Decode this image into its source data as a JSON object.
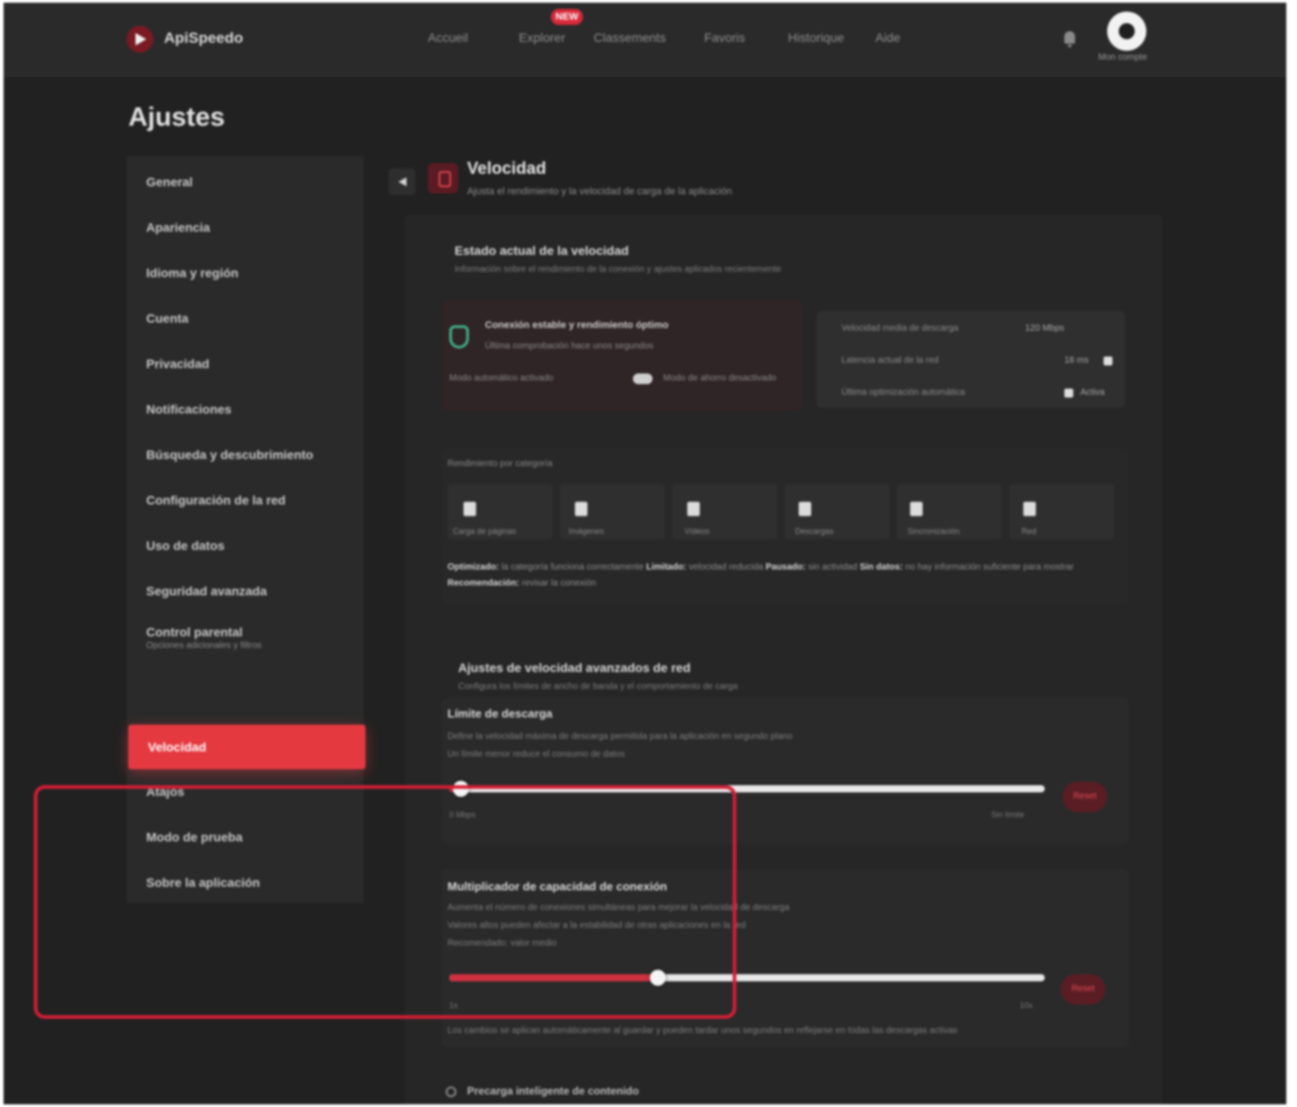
{
  "header": {
    "logo_text": "ApiSpeedo",
    "nav": [
      {
        "label": "Accueil"
      },
      {
        "label": "Explorer"
      },
      {
        "label": "Classements"
      },
      {
        "label": "Favoris"
      },
      {
        "label": "Historique"
      },
      {
        "label": "Aide"
      }
    ],
    "nav_badge": "NEW",
    "avatar_caption": "Mon compte"
  },
  "page_title": "Ajustes",
  "sidebar": {
    "items": [
      {
        "label": "General"
      },
      {
        "label": "Apariencia"
      },
      {
        "label": "Idioma y región"
      },
      {
        "label": "Cuenta"
      },
      {
        "label": "Privacidad"
      },
      {
        "label": "Notificaciones"
      },
      {
        "label": "Búsqueda y descubrimiento"
      },
      {
        "label": "Configuración de la red"
      },
      {
        "label": "Uso de datos"
      },
      {
        "label": "Seguridad avanzada"
      },
      {
        "label": "Control parental",
        "sub": "Opciones adicionales y filtros"
      },
      {
        "label": "Velocidad",
        "active": true
      },
      {
        "label": "Atajos"
      },
      {
        "label": "Modo de prueba"
      },
      {
        "label": "Sobre la aplicación"
      }
    ]
  },
  "section": {
    "title": "Velocidad",
    "subtitle": "Ajusta el rendimiento y la velocidad de carga de la aplicación"
  },
  "status": {
    "block_title": "Estado actual de la velocidad",
    "block_desc": "Información sobre el rendimiento de la conexión y ajustes aplicados recientemente",
    "headline": "Conexión estable y rendimiento óptimo",
    "detail": "Última comprobación hace unos segundos",
    "footer_left": "Modo automático activado",
    "footer_right": "Modo de ahorro desactivado",
    "info_rows": [
      {
        "label": "Velocidad media de descarga",
        "value": "120 Mbps"
      },
      {
        "label": "Latencia actual de la red",
        "value": "18 ms"
      },
      {
        "label": "Última optimización automática",
        "value": "Activa"
      }
    ]
  },
  "stats": {
    "title": "Rendimiento por categoría",
    "cells": [
      {
        "label": "Carga de páginas"
      },
      {
        "label": "Imágenes"
      },
      {
        "label": "Vídeos"
      },
      {
        "label": "Descargas"
      },
      {
        "label": "Sincronización"
      },
      {
        "label": "Red"
      }
    ],
    "legend_parts": [
      {
        "strong": "Optimizado:",
        "text": "la categoría funciona correctamente"
      },
      {
        "strong": "Limitado:",
        "text": "velocidad reducida"
      },
      {
        "strong": "Pausado:",
        "text": "sin actividad"
      },
      {
        "strong": "Sin datos:",
        "text": "no hay información suficiente para mostrar"
      }
    ],
    "legend_second_strong": "Recomendación:",
    "legend_second_text": "revisar la conexión"
  },
  "tuning": {
    "block_title": "Ajustes de velocidad avanzados de red",
    "block_desc": "Configura los límites de ancho de banda y el comportamiento de carga",
    "slider1": {
      "title": "Límite de descarga",
      "desc1": "Define la velocidad máxima de descarga permitida para la aplicación en segundo plano",
      "desc2": "Un límite menor reduce el consumo de datos",
      "value": 0.02,
      "min_label": "0 Mbps",
      "max_label": "Sin límite",
      "reset": "Reset"
    },
    "slider2": {
      "title": "Multiplicador de capacidad de conexión",
      "desc1": "Aumenta el número de conexiones simultáneas para mejorar la velocidad de descarga",
      "desc2": "Valores altos pueden afectar a la estabilidad de otras aplicaciones en la red",
      "desc3": "Recomendado: valor medio",
      "value": 0.35,
      "min_label": "1x",
      "max_label": "10x",
      "reset": "Reset"
    },
    "footnote": "Los cambios se aplican automáticamente al guardar y pueden tardar unos segundos en reflejarse en todas las descargas activas"
  },
  "bottom_row": "Precarga inteligente de contenido",
  "colors": {
    "accent": "#e53940",
    "background": "#212121",
    "highlight": "#d41e35"
  }
}
